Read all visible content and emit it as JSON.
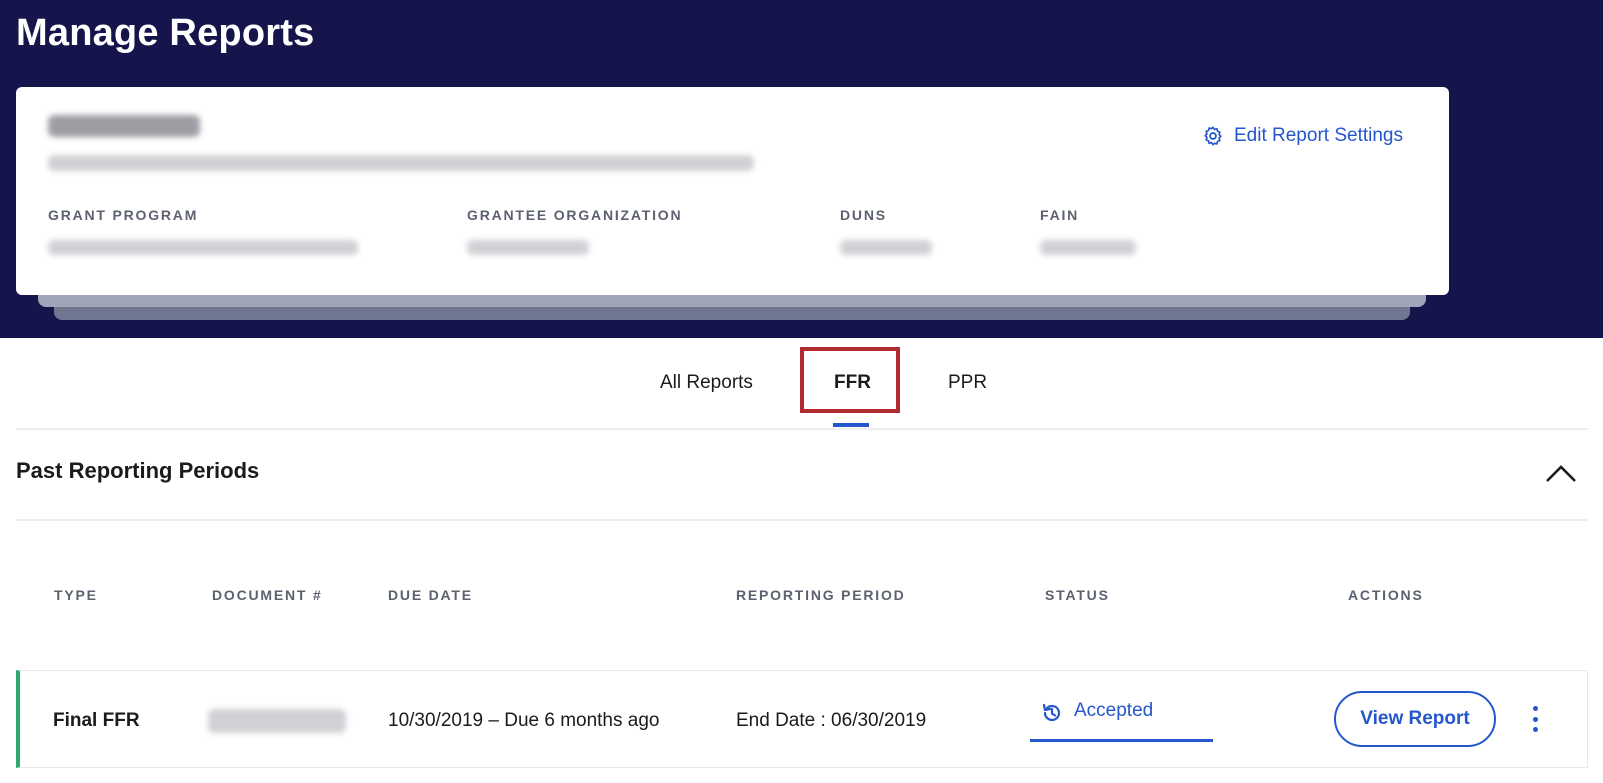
{
  "page": {
    "title": "Manage Reports"
  },
  "grant_card": {
    "edit_settings_label": "Edit Report Settings",
    "fields": {
      "grant_program_label": "GRANT PROGRAM",
      "grantee_org_label": "GRANTEE ORGANIZATION",
      "duns_label": "DUNS",
      "fain_label": "FAIN"
    }
  },
  "tabs": [
    {
      "label": "All Reports",
      "active": false
    },
    {
      "label": "FFR",
      "active": true
    },
    {
      "label": "PPR",
      "active": false
    }
  ],
  "section": {
    "title": "Past Reporting Periods"
  },
  "table": {
    "columns": [
      "TYPE",
      "DOCUMENT #",
      "DUE DATE",
      "REPORTING PERIOD",
      "STATUS",
      "ACTIONS"
    ],
    "rows": [
      {
        "type": "Final FFR",
        "due_date": "10/30/2019 – Due 6 months ago",
        "reporting_period": "End Date : 06/30/2019",
        "status": "Accepted",
        "action_label": "View Report"
      }
    ]
  },
  "colors": {
    "header_bg": "#15154c",
    "accent": "#2456cc",
    "highlight_box": "#b02a2f",
    "row_accent": "#2fa86b"
  },
  "icons": {
    "edit_settings": "gear-icon",
    "status": "history-icon",
    "collapse": "chevron-up-icon",
    "more": "kebab-menu-icon"
  }
}
